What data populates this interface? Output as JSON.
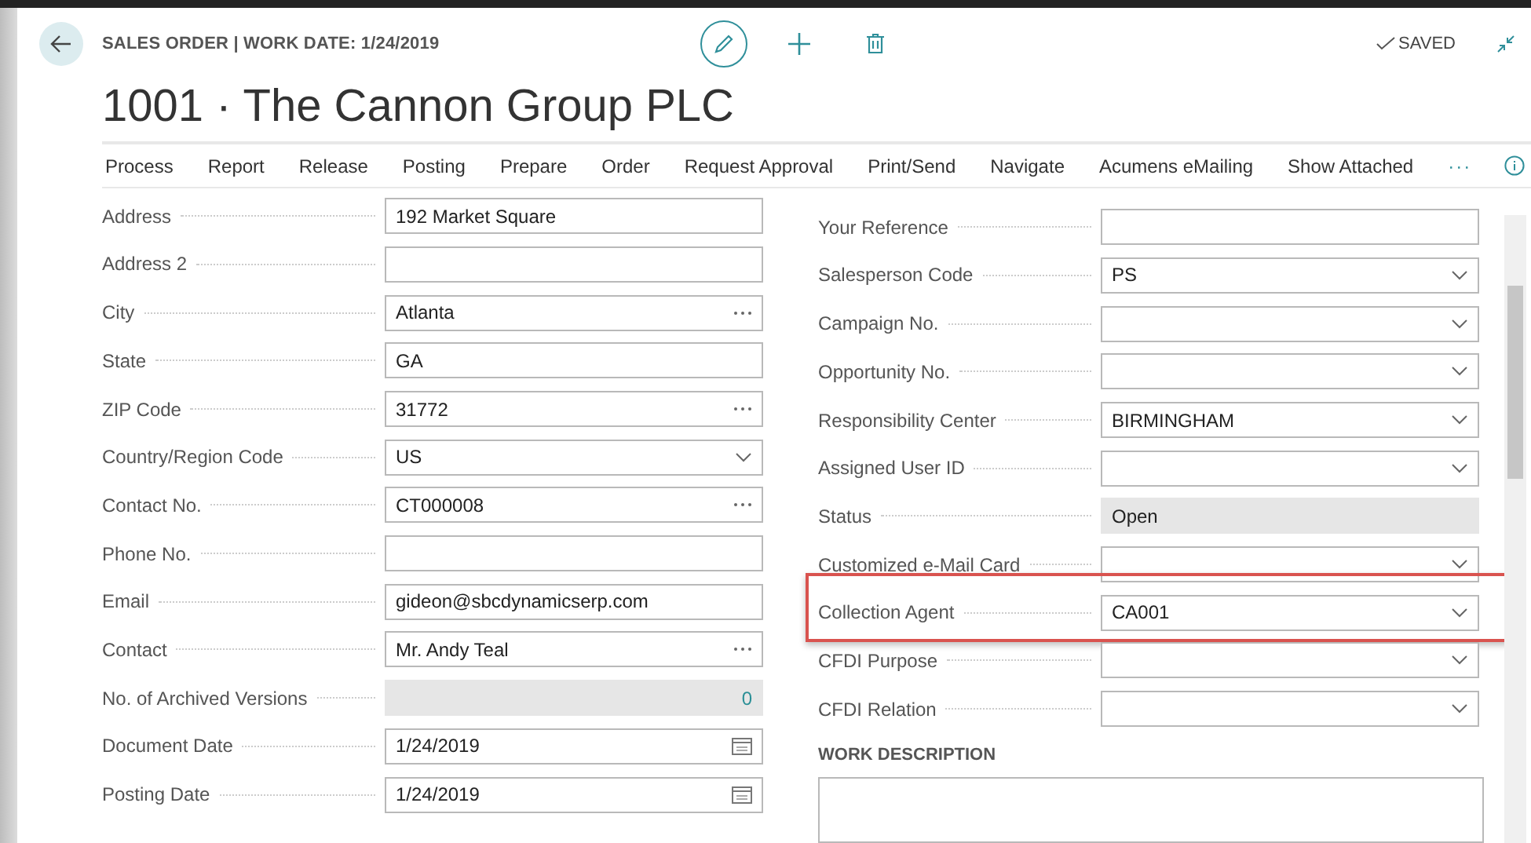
{
  "header": {
    "caption": "SALES ORDER | WORK DATE: 1/24/2019",
    "title": "1001 · The Cannon Group PLC",
    "status": "SAVED"
  },
  "actions": [
    "Process",
    "Report",
    "Release",
    "Posting",
    "Prepare",
    "Order",
    "Request Approval",
    "Print/Send",
    "Navigate",
    "Acumens eMailing",
    "Show Attached",
    "···"
  ],
  "left_fields": [
    {
      "label": "Address",
      "value": "192 Market Square",
      "kind": "text"
    },
    {
      "label": "Address 2",
      "kind": "text"
    },
    {
      "label": "City",
      "value": "Atlanta",
      "kind": "lookup"
    },
    {
      "label": "State",
      "value": "GA",
      "kind": "text"
    },
    {
      "label": "ZIP Code",
      "value": "31772",
      "kind": "lookup"
    },
    {
      "label": "Country/Region Code",
      "value": "US",
      "kind": "dropdown"
    },
    {
      "label": "Contact No.",
      "value": "CT000008",
      "kind": "lookup"
    },
    {
      "label": "Phone No.",
      "kind": "text"
    },
    {
      "label": "Email",
      "value": "gideon@sbcdynamicserp.com",
      "kind": "text"
    },
    {
      "label": "Contact",
      "value": "Mr. Andy Teal",
      "kind": "lookup"
    },
    {
      "label": "No. of Archived Versions",
      "value": "0",
      "kind": "number"
    },
    {
      "label": "Document Date",
      "value": "1/24/2019",
      "kind": "date"
    },
    {
      "label": "Posting Date",
      "value": "1/24/2019",
      "kind": "date"
    }
  ],
  "right_fields": [
    {
      "label": "Your Reference",
      "kind": "text",
      "highlighted": false
    },
    {
      "label": "Salesperson Code",
      "value": "PS",
      "kind": "dropdown",
      "highlighted": false
    },
    {
      "label": "Campaign No.",
      "kind": "dropdown",
      "highlighted": false
    },
    {
      "label": "Opportunity No.",
      "kind": "dropdown",
      "highlighted": false
    },
    {
      "label": "Responsibility Center",
      "value": "BIRMINGHAM",
      "kind": "dropdown",
      "highlighted": false
    },
    {
      "label": "Assigned User ID",
      "kind": "dropdown",
      "highlighted": false
    },
    {
      "label": "Status",
      "value": "Open",
      "kind": "readonly",
      "highlighted": false
    },
    {
      "label": "Customized e-Mail Card",
      "kind": "dropdown",
      "highlighted": false
    },
    {
      "label": "Collection Agent",
      "value": "CA001",
      "kind": "dropdown",
      "highlighted": true
    },
    {
      "label": "CFDI Purpose",
      "kind": "dropdown",
      "highlighted": false
    },
    {
      "label": "CFDI Relation",
      "kind": "dropdown",
      "highlighted": false
    }
  ],
  "work_description": {
    "heading": "WORK DESCRIPTION"
  }
}
